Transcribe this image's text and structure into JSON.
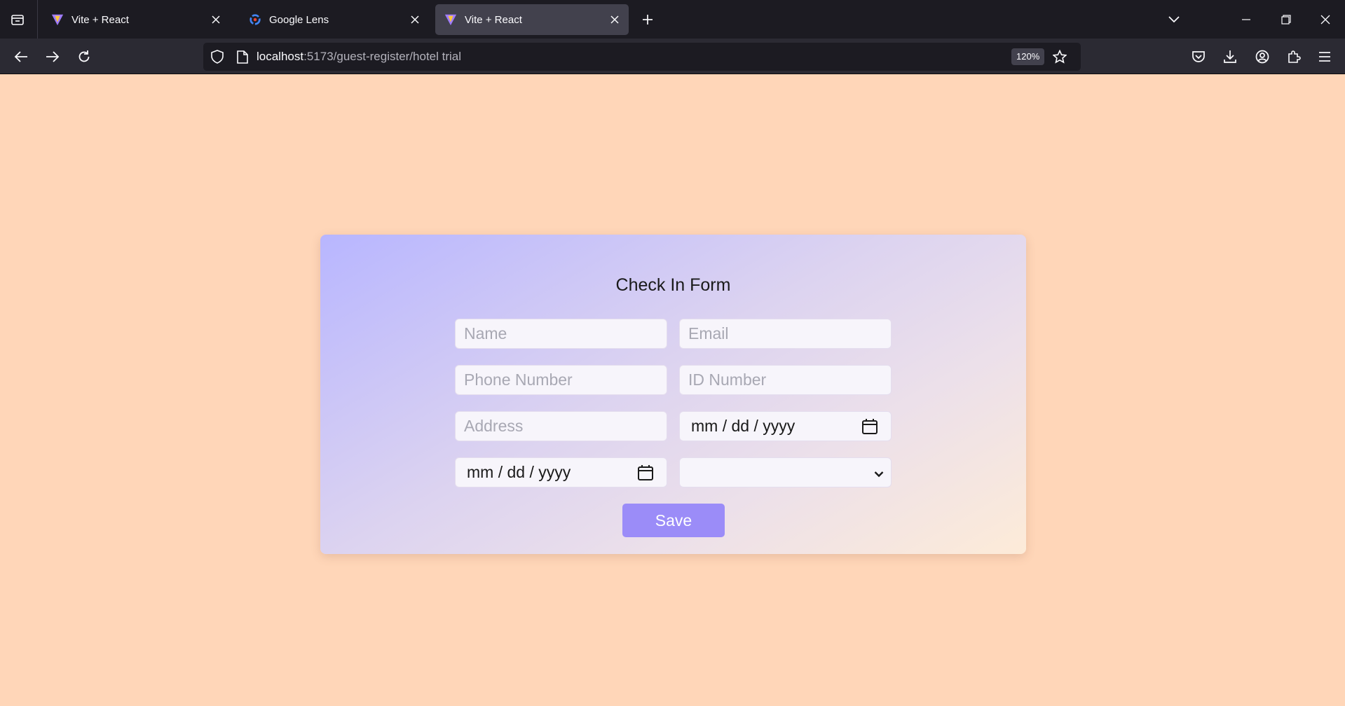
{
  "browser": {
    "tabs": [
      {
        "title": "Vite + React",
        "favicon": "vite-logo-icon",
        "active": false
      },
      {
        "title": "Google Lens",
        "favicon": "google-lens-icon",
        "active": false
      },
      {
        "title": "Vite + React",
        "favicon": "vite-logo-icon",
        "active": true
      }
    ],
    "url": {
      "host": "localhost",
      "path": ":5173/guest-register/hotel trial"
    },
    "zoom": "120%"
  },
  "form": {
    "title": "Check In Form",
    "fields": {
      "name": {
        "placeholder": "Name",
        "value": ""
      },
      "email": {
        "placeholder": "Email",
        "value": ""
      },
      "phone": {
        "placeholder": "Phone Number",
        "value": ""
      },
      "id_number": {
        "placeholder": "ID Number",
        "value": ""
      },
      "address": {
        "placeholder": "Address",
        "value": ""
      },
      "date_1": {
        "display": "mm / dd / yyyy"
      },
      "date_2": {
        "display": "mm / dd / yyyy"
      },
      "select": {
        "selected": ""
      }
    },
    "save_label": "Save"
  },
  "colors": {
    "page_background": "#ffd6b8",
    "save_button": "#9b8cf8",
    "card_gradient_start": "#b8b6ff",
    "card_gradient_end": "#fdebd8"
  }
}
